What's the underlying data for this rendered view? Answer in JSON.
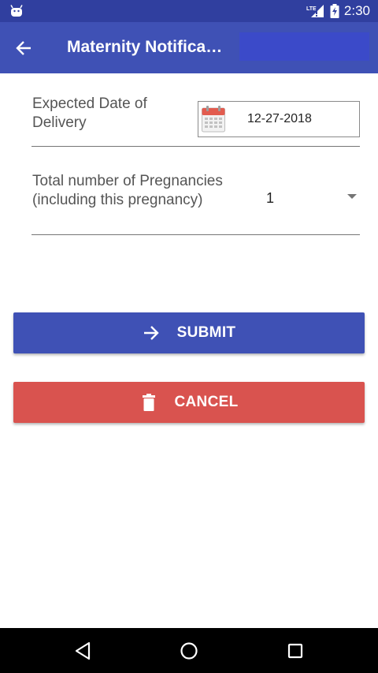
{
  "status_bar": {
    "time": "2:30",
    "network": "LTE",
    "icons": [
      "android-icon",
      "lte-signal-icon",
      "battery-icon"
    ]
  },
  "app_bar": {
    "title": "Maternity Notifica…",
    "back_icon": "arrow-left-icon"
  },
  "form": {
    "edd": {
      "label": "Expected Date of Delivery",
      "value": "12-27-2018",
      "icon": "calendar-icon"
    },
    "pregnancies": {
      "label": "Total number of Pregnancies (including this pregnancy)",
      "value": "1"
    }
  },
  "buttons": {
    "submit": {
      "label": "SUBMIT",
      "icon": "arrow-right-icon",
      "color": "#3F51B5"
    },
    "cancel": {
      "label": "CANCEL",
      "icon": "trash-icon",
      "color": "#D9534F"
    }
  },
  "nav_bar": {
    "icons": [
      "back-triangle-icon",
      "home-circle-icon",
      "recents-square-icon"
    ]
  },
  "colors": {
    "primary": "#3F51B5",
    "primary_dark": "#303F9F",
    "danger": "#D9534F"
  }
}
